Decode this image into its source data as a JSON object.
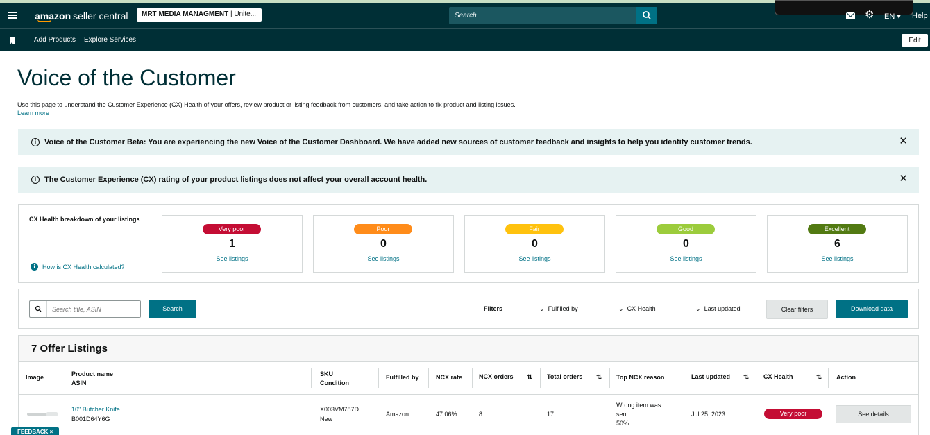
{
  "header": {
    "brand_bold": "amazon",
    "brand_rest": "seller central",
    "account_name": "MRT MEDIA MANAGMENT",
    "account_region": " | Unite...",
    "search_placeholder": "Search",
    "language": "EN ▾",
    "help": "Help"
  },
  "nav": {
    "links": [
      "Add Products",
      "Explore Services"
    ],
    "edit": "Edit"
  },
  "page": {
    "title": "Voice of the Customer",
    "description": "Use this page to understand the Customer Experience (CX) Health of your offers, review product or listing feedback from customers, and take action to fix product and listing issues.",
    "learn_more": "Learn more"
  },
  "banners": [
    "Voice of the Customer Beta: You are experiencing the new Voice of the Customer Dashboard. We have added new sources of customer feedback and insights to help you identify customer trends.",
    "The Customer Experience (CX) rating of your product listings does not affect your overall account health."
  ],
  "cx_health": {
    "label": "CX Health breakdown of your listings",
    "help_link": "How is CX Health calculated?",
    "see_listings": "See listings",
    "categories": [
      {
        "name": "Very poor",
        "count": "1",
        "color": "#c40d34"
      },
      {
        "name": "Poor",
        "count": "0",
        "color": "#ff8c1a"
      },
      {
        "name": "Fair",
        "count": "0",
        "color": "#ffc20e"
      },
      {
        "name": "Good",
        "count": "0",
        "color": "#9ccc3c"
      },
      {
        "name": "Excellent",
        "count": "6",
        "color": "#527a12"
      }
    ]
  },
  "filters": {
    "search_placeholder": "Search title, ASIN",
    "search_button": "Search",
    "label": "Filters",
    "dropdowns": [
      "Fulfilled by",
      "CX Health",
      "Last updated"
    ],
    "clear": "Clear filters",
    "download": "Download data"
  },
  "table": {
    "title": "7 Offer Listings",
    "headers": {
      "image": "Image",
      "product_name": "Product name",
      "asin": "ASIN",
      "sku": "SKU",
      "condition": "Condition",
      "fulfilled_by": "Fulfilled by",
      "ncx_rate": "NCX rate",
      "ncx_orders": "NCX orders",
      "total_orders": "Total orders",
      "top_reason": "Top NCX reason",
      "last_updated": "Last updated",
      "cx_health": "CX Health",
      "action": "Action"
    },
    "rows": [
      {
        "product_name": "10\" Butcher Knife",
        "asin": "B001D64Y6G",
        "sku": "X003VM787D",
        "condition": "New",
        "fulfilled_by": "Amazon",
        "ncx_rate": "47.06%",
        "ncx_orders": "8",
        "total_orders": "17",
        "top_reason_1": "Wrong item was",
        "top_reason_2": "sent",
        "top_reason_pct": "50%",
        "last_updated": "Jul 25, 2023",
        "cx_health": "Very poor",
        "action": "See details"
      }
    ]
  },
  "feedback": "FEEDBACK ×"
}
